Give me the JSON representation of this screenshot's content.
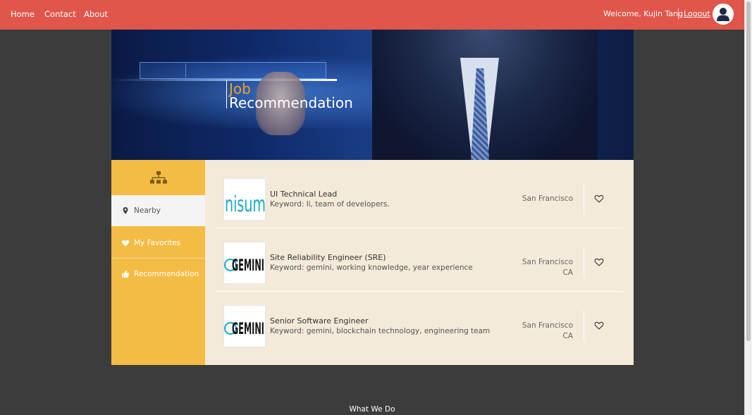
{
  "nav": {
    "links": [
      "Home",
      "Contact",
      "About"
    ],
    "welcome": "Welcome, Kujin Tang",
    "logout": "Logout",
    "avatar_icon": "user-avatar-icon"
  },
  "hero": {
    "title_line1": "Job",
    "title_line2": "Recommendation"
  },
  "sidebar": {
    "top_icon": "sitemap-icon",
    "items": [
      {
        "label": "Nearby",
        "icon": "map-marker-icon",
        "active": true
      },
      {
        "label": "My Favorites",
        "icon": "heart-icon",
        "active": false
      },
      {
        "label": "Recommendation",
        "icon": "thumbs-up-icon",
        "active": false
      }
    ]
  },
  "jobs": [
    {
      "logo_text": "nisum",
      "title": "UI Technical Lead",
      "keyword": "Keyword: li, team of developers.",
      "location_line1": "San Francisco",
      "location_line2": "",
      "favorite": false
    },
    {
      "logo_text": "GEMINI",
      "title": "Site Reliability Engineer (SRE)",
      "keyword": "Keyword: gemini, working knowledge, year experience",
      "location_line1": "San Francisco",
      "location_line2": "CA",
      "favorite": false
    },
    {
      "logo_text": "GEMINI",
      "title": "Senior Software Engineer",
      "keyword": "Keyword: gemini, blockchain technology, engineering team",
      "location_line1": "San Francisco",
      "location_line2": "CA",
      "favorite": false
    }
  ],
  "footer": {
    "label": "What We Do"
  },
  "colors": {
    "nav_bg": "#e0564b",
    "sidebar_bg": "#f3bc45",
    "list_bg": "#f3ead9",
    "page_bg": "#3c3c3c",
    "hero_accent": "#f0a030"
  }
}
